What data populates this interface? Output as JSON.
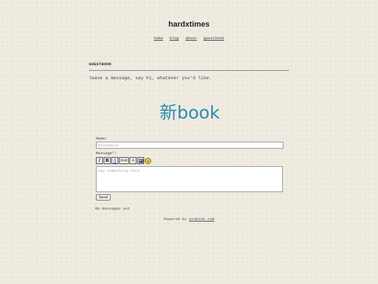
{
  "site": {
    "title": "hardxtimes"
  },
  "nav": {
    "items": [
      {
        "label": "home"
      },
      {
        "label": "blog"
      },
      {
        "label": "about"
      },
      {
        "label": "guestbook"
      }
    ]
  },
  "section": {
    "heading": "GUESTBOOK",
    "intro": "leave a message, say hi, whatever you'd like."
  },
  "guestbook": {
    "logo_char": "新",
    "logo_text": "book",
    "logo_color": "#2a8cb4",
    "name_label": "Name:",
    "name_placeholder": "Anonymous",
    "message_label": "Message*:",
    "message_placeholder": "Say something nice",
    "toolbar": {
      "italic": "I",
      "bold": "B",
      "color": "A",
      "font": "font",
      "size": "A"
    },
    "send_label": "Send",
    "no_messages": "No messages yet",
    "powered_prefix": "Powered by ",
    "powered_link": "atabook.com"
  }
}
